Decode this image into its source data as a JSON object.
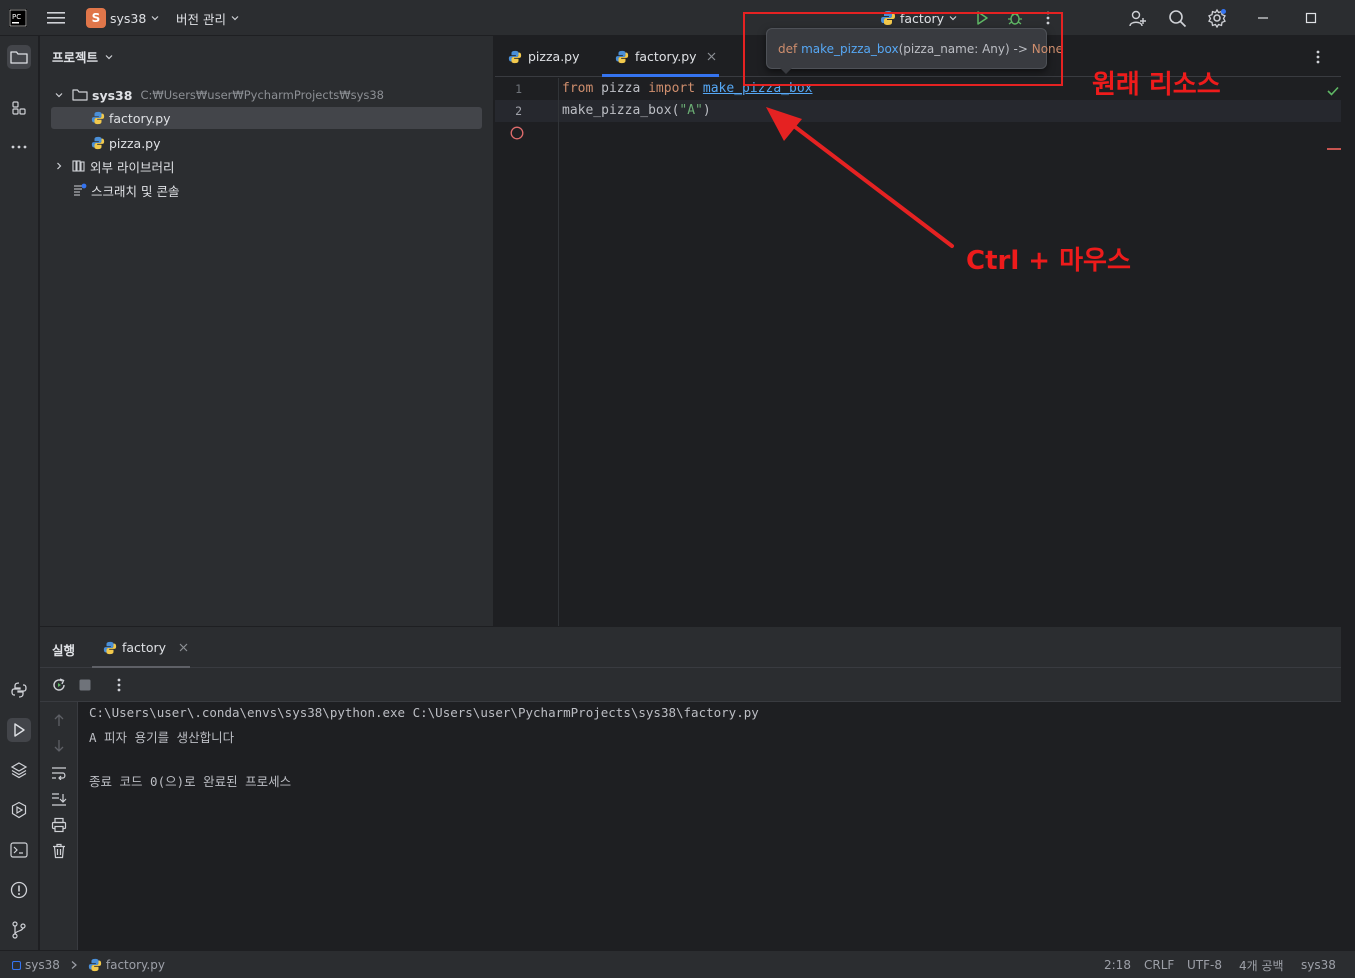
{
  "titlebar": {
    "project_badge": "S",
    "project_name": "sys38",
    "vcs_label": "버전 관리",
    "run_config": "factory"
  },
  "project_panel": {
    "title": "프로젝트",
    "root_name": "sys38",
    "root_path": "C:₩Users₩user₩PycharmProjects₩sys38",
    "files": [
      "factory.py",
      "pizza.py"
    ],
    "external_libs": "외부 라이브러리",
    "scratches": "스크래치 및 콘솔"
  },
  "editor": {
    "tabs": [
      {
        "label": "pizza.py"
      },
      {
        "label": "factory.py"
      }
    ],
    "line_numbers": [
      "1",
      "2"
    ],
    "line1": {
      "kw_from": "from",
      "module": "pizza",
      "kw_import": "import",
      "name": "make_pizza_box"
    },
    "line2": {
      "call": "make_pizza_box(",
      "arg": "\"A\"",
      "close": ")"
    }
  },
  "tooltip": {
    "def": "def",
    "fn": "make_pizza_box",
    "params": "(pizza_name: Any) ->",
    "ret": "None"
  },
  "run_panel": {
    "title": "실행",
    "tab": "factory",
    "output": [
      "C:\\Users\\user\\.conda\\envs\\sys38\\python.exe C:\\Users\\user\\PycharmProjects\\sys38\\factory.py",
      "A 피자 용기를 생산합니다",
      "",
      "종료 코드 0(으)로 완료된 프로세스"
    ]
  },
  "statusbar": {
    "crumb_project": "sys38",
    "crumb_file": "factory.py",
    "position": "2:18",
    "line_sep": "CRLF",
    "encoding": "UTF-8",
    "indent": "4개 공백",
    "interpreter": "sys38"
  },
  "annotations": {
    "original_source": "원래 리소스",
    "ctrl_mouse": "Ctrl + 마우스"
  },
  "colors": {
    "accent": "#3574f0",
    "annotation_red": "#e52222",
    "keyword": "#cf8e6d",
    "function": "#56a8f5",
    "string": "#6aab73"
  }
}
